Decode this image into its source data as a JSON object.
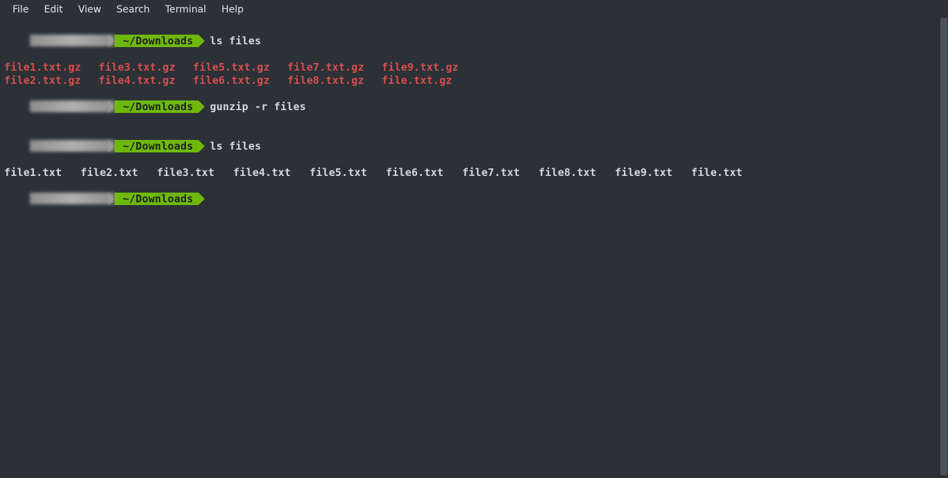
{
  "menubar": {
    "items": [
      "File",
      "Edit",
      "View",
      "Search",
      "Terminal",
      "Help"
    ]
  },
  "prompt": {
    "path": "~/Downloads"
  },
  "commands": {
    "c1": "ls files",
    "c2": "gunzip -r files",
    "c3": "ls files",
    "c4": ""
  },
  "output_gz": {
    "col1": [
      "file1.txt.gz",
      "file2.txt.gz"
    ],
    "col2": [
      "file3.txt.gz",
      "file4.txt.gz"
    ],
    "col3": [
      "file5.txt.gz",
      "file6.txt.gz"
    ],
    "col4": [
      "file7.txt.gz",
      "file8.txt.gz"
    ],
    "col5": [
      "file9.txt.gz",
      "file.txt.gz"
    ]
  },
  "output_txt": {
    "row": [
      "file1.txt",
      "file2.txt",
      "file3.txt",
      "file4.txt",
      "file5.txt",
      "file6.txt",
      "file7.txt",
      "file8.txt",
      "file9.txt",
      "file.txt"
    ]
  }
}
